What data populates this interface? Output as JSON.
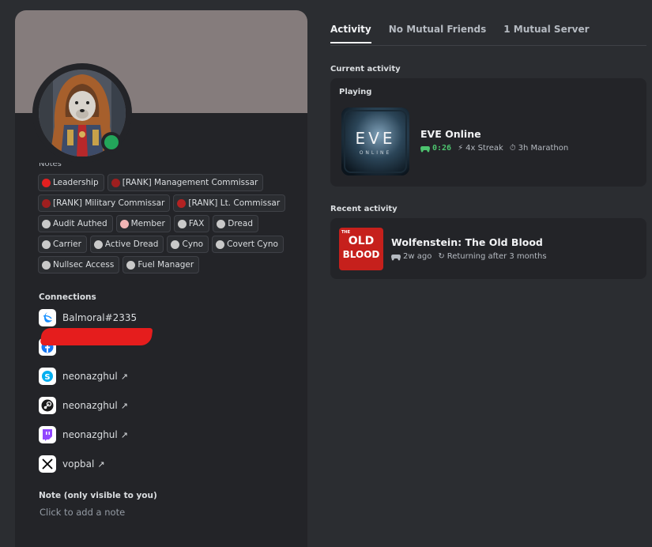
{
  "profile": {
    "notes_heading": "Notes",
    "roles": [
      {
        "label": "Leadership",
        "color": "#e32020"
      },
      {
        "label": "[RANK] Management Commissar",
        "color": "#9e1f1f"
      },
      {
        "label": "[RANK] Military Commissar",
        "color": "#9e1f1f"
      },
      {
        "label": "[RANK] Lt. Commissar",
        "color": "#b32222"
      },
      {
        "label": "Audit Authed",
        "color": "#c9c9c9"
      },
      {
        "label": "Member",
        "color": "#f1b5b5"
      },
      {
        "label": "FAX",
        "color": "#c9c9c9"
      },
      {
        "label": "Dread",
        "color": "#c9c9c9"
      },
      {
        "label": "Carrier",
        "color": "#c9c9c9"
      },
      {
        "label": "Active Dread",
        "color": "#c9c9c9"
      },
      {
        "label": "Cyno",
        "color": "#c9c9c9"
      },
      {
        "label": "Covert Cyno",
        "color": "#c9c9c9"
      },
      {
        "label": "Nullsec Access",
        "color": "#c9c9c9"
      },
      {
        "label": "Fuel Manager",
        "color": "#c9c9c9"
      }
    ],
    "connections_label": "Connections",
    "connections": [
      {
        "service": "battlenet-icon",
        "name": "Balmoral#2335",
        "arrow": ""
      },
      {
        "service": "facebook-icon",
        "name": "",
        "arrow": ""
      },
      {
        "service": "skype-icon",
        "name": "neonazghul",
        "arrow": "↗"
      },
      {
        "service": "steam-icon",
        "name": "neonazghul",
        "arrow": "↗"
      },
      {
        "service": "twitch-icon",
        "name": "neonazghul",
        "arrow": "↗"
      },
      {
        "service": "x-icon",
        "name": "vopbal",
        "arrow": "↗"
      }
    ],
    "note_label": "Note (only visible to you)",
    "note_placeholder": "Click to add a note"
  },
  "tabs": [
    {
      "label": "Activity",
      "active": true
    },
    {
      "label": "No Mutual Friends",
      "active": false
    },
    {
      "label": "1 Mutual Server",
      "active": false
    }
  ],
  "current_activity": {
    "label": "Current activity",
    "playing_label": "Playing",
    "game": "EVE Online",
    "logo_text": "EVE",
    "logo_sub": "ONLINE",
    "time": "0:26",
    "streak": "4x Streak",
    "marathon": "3h Marathon"
  },
  "recent_activity": {
    "label": "Recent activity",
    "game": "Wolfenstein: The Old Blood",
    "cover_the": "THE",
    "cover_old": "OLD",
    "cover_blood": "BLOOD",
    "when": "2w ago",
    "status": "Returning after 3 months"
  },
  "colors": {
    "online": "#23a55a",
    "accent_green": "#4dc46f",
    "banner": "#857c7c"
  }
}
